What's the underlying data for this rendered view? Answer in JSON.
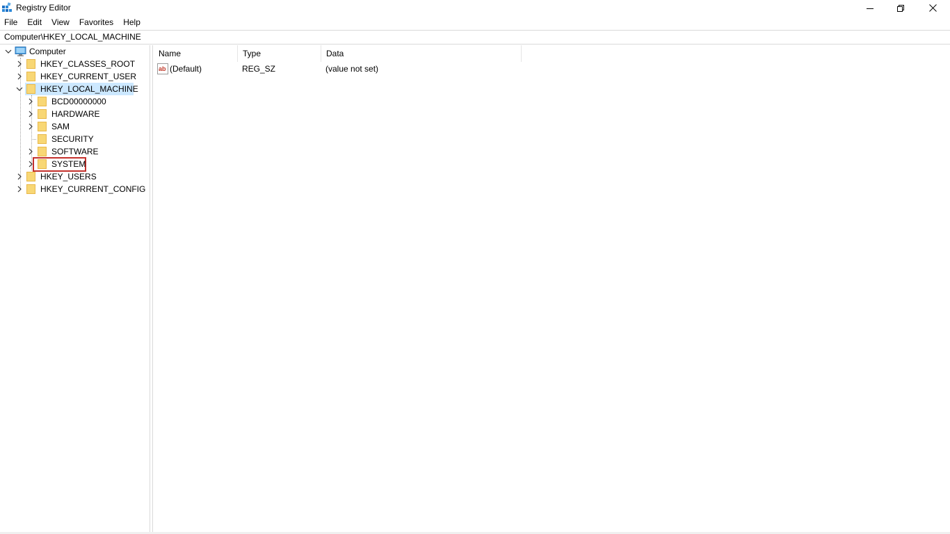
{
  "window": {
    "title": "Registry Editor"
  },
  "menu": {
    "items": [
      "File",
      "Edit",
      "View",
      "Favorites",
      "Help"
    ]
  },
  "address": {
    "value": "Computer\\HKEY_LOCAL_MACHINE"
  },
  "tree": {
    "root": "Computer",
    "nodes": [
      {
        "label": "HKEY_CLASSES_ROOT",
        "expanded": false
      },
      {
        "label": "HKEY_CURRENT_USER",
        "expanded": false
      },
      {
        "label": "HKEY_LOCAL_MACHINE",
        "expanded": true,
        "selected": true
      },
      {
        "label": "BCD00000000",
        "expanded": false
      },
      {
        "label": "HARDWARE",
        "expanded": false
      },
      {
        "label": "SAM",
        "expanded": false
      },
      {
        "label": "SECURITY",
        "expanded": false
      },
      {
        "label": "SOFTWARE",
        "expanded": false
      },
      {
        "label": "SYSTEM",
        "expanded": false,
        "highlighted": true
      },
      {
        "label": "HKEY_USERS",
        "expanded": false
      },
      {
        "label": "HKEY_CURRENT_CONFIG",
        "expanded": false
      }
    ]
  },
  "list": {
    "columns": [
      "Name",
      "Type",
      "Data"
    ],
    "rows": [
      {
        "name": "(Default)",
        "type": "REG_SZ",
        "data": "(value not set)"
      }
    ]
  },
  "colors": {
    "selection": "#cce8ff",
    "highlight_box": "#c4302b",
    "folder": "#f8d775",
    "folder_dark": "#e8b84a"
  },
  "icons": {
    "app": "registry-editor-icon",
    "root": "computer-icon",
    "node": "folder-icon",
    "value": "string-value-icon"
  }
}
